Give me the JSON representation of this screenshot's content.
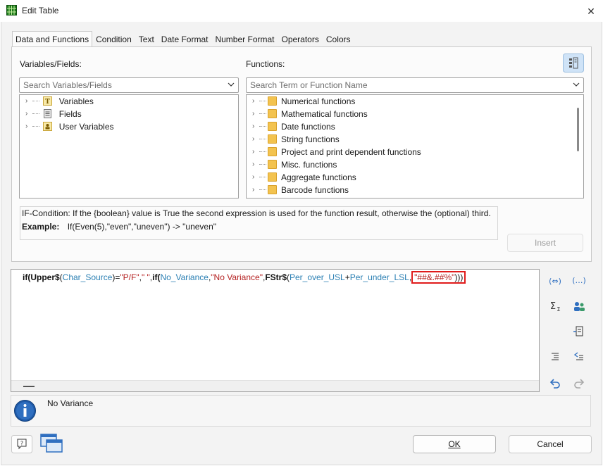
{
  "window": {
    "title": "Edit Table",
    "close_glyph": "✕"
  },
  "tabs": [
    {
      "label": "Data and Functions",
      "active": true
    },
    {
      "label": "Condition"
    },
    {
      "label": "Text"
    },
    {
      "label": "Date Format"
    },
    {
      "label": "Number Format"
    },
    {
      "label": "Operators"
    },
    {
      "label": "Colors"
    }
  ],
  "variables": {
    "label": "Variables/Fields:",
    "search_placeholder": "Search Variables/Fields",
    "items": [
      "Variables",
      "Fields",
      "User Variables"
    ]
  },
  "functions": {
    "label": "Functions:",
    "search_placeholder": "Search Term or Function Name",
    "items": [
      "Numerical functions",
      "Mathematical functions",
      "Date functions",
      "String functions",
      "Project and print dependent functions",
      "Misc. functions",
      "Aggregate functions",
      "Barcode functions"
    ]
  },
  "description": {
    "text": "IF-Condition: If the {boolean} value is True the second expression is used for the function result, otherwise the (optional) third.",
    "example_label": "Example:",
    "example_value": "If(Even(5),\"even\",\"uneven\") -> \"uneven\""
  },
  "insert_button": "Insert",
  "formula": {
    "t1": "if(",
    "t2": "Upper$",
    "t3": "(",
    "t4": "Char_Source",
    "t5": ")=",
    "t6": "\"P/F\"",
    "t7": ",",
    "t8": "\" \"",
    "t9": ",",
    "t10": "if(",
    "t11": "No_Variance",
    "t12": ",",
    "t13": "\"No Variance\"",
    "t14": ",",
    "t15": "FStr$",
    "t16": "(",
    "t17": "Per_over_USL",
    "t18": "+",
    "t19": "Per_under_LSL",
    "t20": ",",
    "t21": "\"##&.##%\"",
    "t22": ")))"
  },
  "result": {
    "text": "No Variance"
  },
  "ok_button": "OK",
  "cancel_button": "Cancel",
  "colors": {
    "field": "#2a7fb3",
    "string": "#b41f1f",
    "highlight": "#e01b1b",
    "accent": "#2f6fc0"
  }
}
